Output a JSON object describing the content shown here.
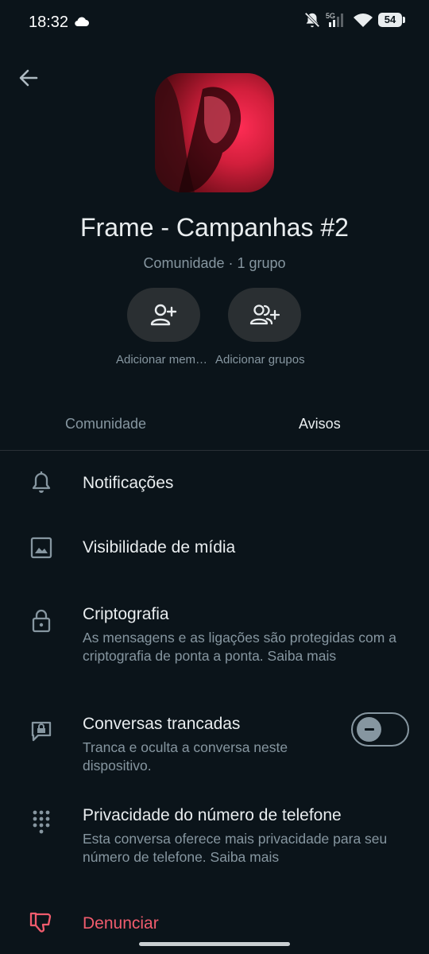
{
  "status_bar": {
    "time": "18:32",
    "battery_level": "54",
    "network": "5G"
  },
  "group": {
    "title": "Frame - Campanhas #2",
    "subtitle": "Comunidade · 1 grupo"
  },
  "actions": [
    {
      "label": "Adicionar mem…",
      "icon": "add-person-icon"
    },
    {
      "label": "Adicionar grupos",
      "icon": "add-group-icon"
    }
  ],
  "tabs": [
    {
      "label": "Comunidade",
      "active": false
    },
    {
      "label": "Avisos",
      "active": true
    }
  ],
  "settings": {
    "notifications": {
      "title": "Notificações",
      "icon": "bell-icon"
    },
    "media_visibility": {
      "title": "Visibilidade de mídia",
      "icon": "image-icon"
    },
    "encryption": {
      "title": "Criptografia",
      "description": "As mensagens e as ligações são protegidas com a criptografia de ponta a ponta. Saiba mais",
      "icon": "lock-icon"
    },
    "locked_chats": {
      "title": "Conversas trancadas",
      "description": "Tranca e oculta a conversa neste dispositivo.",
      "toggle_on": false,
      "icon": "chat-lock-icon"
    },
    "phone_privacy": {
      "title": "Privacidade do número de telefone",
      "description": "Esta conversa oferece mais privacidade para seu número de telefone. Saiba mais",
      "icon": "dialpad-icon"
    },
    "report": {
      "title": "Denunciar",
      "icon": "thumbs-down-icon",
      "color": "#f15c6d"
    }
  },
  "colors": {
    "background": "#0b141a",
    "text_primary": "#e9edef",
    "text_secondary": "#8696a0",
    "danger": "#f15c6d"
  }
}
